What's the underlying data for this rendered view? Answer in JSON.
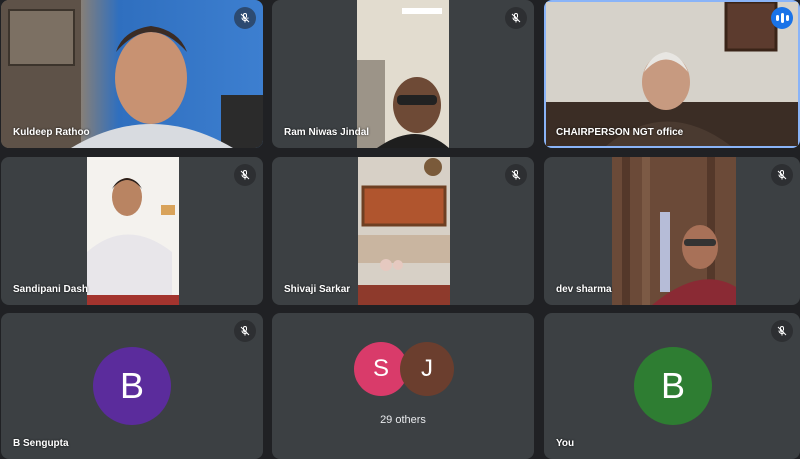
{
  "tiles": [
    {
      "name": "Kuldeep Rathoo",
      "muted": true
    },
    {
      "name": "Ram Niwas Jindal",
      "muted": true
    },
    {
      "name": "CHAIRPERSON NGT office",
      "speaking": true
    },
    {
      "name": "Sandipani Dash",
      "muted": true
    },
    {
      "name": "Shivaji Sarkar",
      "muted": true
    },
    {
      "name": "dev sharma",
      "muted": true
    },
    {
      "name": "B Sengupta",
      "initial": "B",
      "avatar_color": "#5b2c9c",
      "muted": true
    },
    {
      "group_initials": [
        "S",
        "J"
      ],
      "group_colors": [
        "#d93b6a",
        "#6b3e2e"
      ],
      "others_label": "29 others"
    },
    {
      "name": "You",
      "initial": "B",
      "avatar_color": "#2e7d32",
      "muted": true
    }
  ],
  "colors": {
    "background": "#202124",
    "tile": "#3c4043",
    "active_border": "#8ab4f8",
    "speaking": "#1a73e8"
  }
}
